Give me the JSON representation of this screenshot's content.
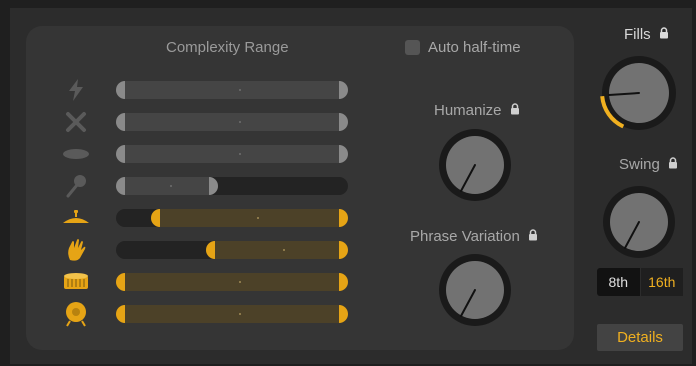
{
  "panel": {
    "complexity_title": "Complexity Range",
    "auto_half_time_label": "Auto half-time"
  },
  "instruments": [
    {
      "icon": "clap-lightning-icon",
      "color": "#5a5a5a",
      "range": "grey"
    },
    {
      "icon": "crossed-sticks-icon",
      "color": "#5a5a5a",
      "range": "grey"
    },
    {
      "icon": "cymbal-flat-icon",
      "color": "#5a5a5a",
      "range": "grey"
    },
    {
      "icon": "shaker-icon",
      "color": "#5a5a5a",
      "range": "grey"
    },
    {
      "icon": "cymbal-icon",
      "color": "#e6a415",
      "range": "gold"
    },
    {
      "icon": "hand-clap-icon",
      "color": "#e6a415",
      "range": "gold"
    },
    {
      "icon": "snare-drum-icon",
      "color": "#e6a415",
      "range": "gold"
    },
    {
      "icon": "kick-drum-icon",
      "color": "#e6a415",
      "range": "gold"
    }
  ],
  "knobs": {
    "humanize_label": "Humanize",
    "phrase_variation_label": "Phrase Variation",
    "fills_label": "Fills",
    "swing_label": "Swing"
  },
  "swing_resolution": {
    "options": [
      "8th",
      "16th"
    ],
    "selected": "16th"
  },
  "details_button": "Details",
  "colors": {
    "accent": "#e6a415",
    "panel": "#353535",
    "background": "#2c2c2c"
  }
}
